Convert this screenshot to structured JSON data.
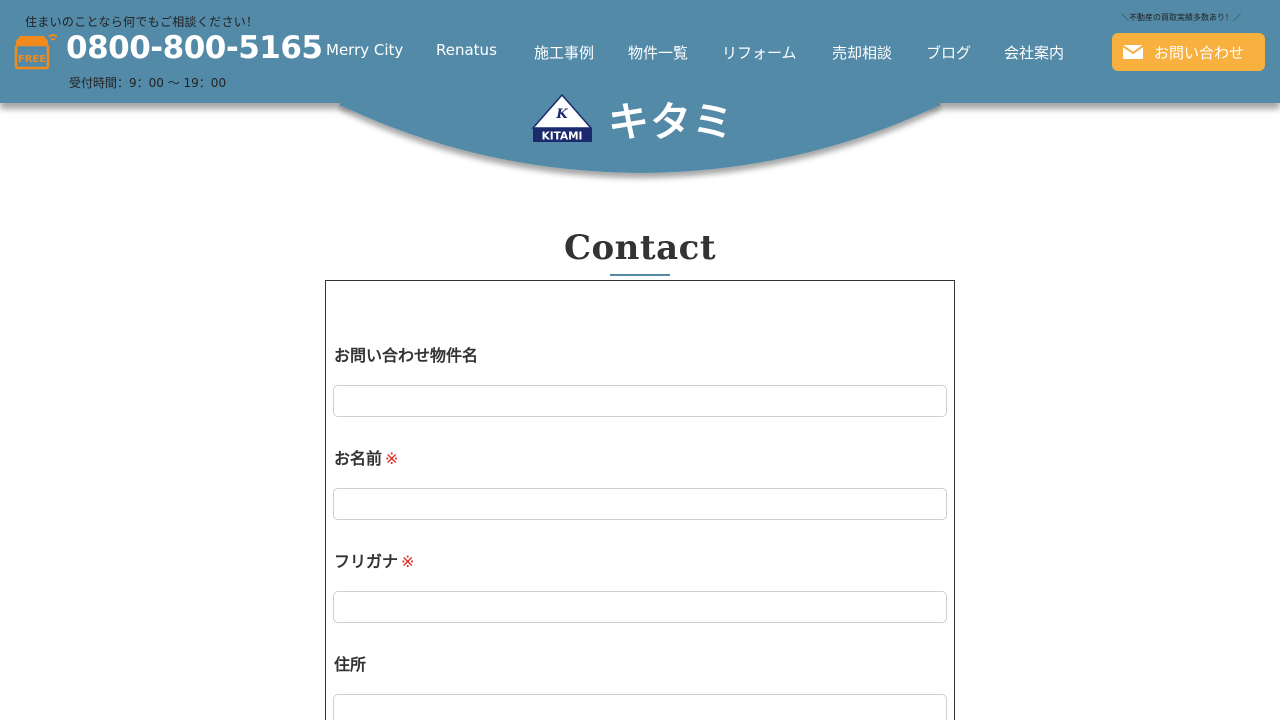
{
  "header": {
    "tagline": "住まいのことなら何でもご相談ください！",
    "phone": "0800-800-5165",
    "hours": "受付時間：9：00 〜 19：00",
    "buy_note": "＼不動産の買取実績多数あり！／",
    "contact_button": "お問い合わせ",
    "logo": {
      "badge_text": "KITAMI",
      "wordmark": "キタミ"
    },
    "nav": [
      {
        "label": "Merry City"
      },
      {
        "label": "Renatus"
      },
      {
        "label": "施工事例"
      },
      {
        "label": "物件一覧"
      },
      {
        "label": "リフォーム"
      },
      {
        "label": "売却相談"
      },
      {
        "label": "ブログ"
      },
      {
        "label": "会社案内"
      }
    ]
  },
  "main": {
    "title": "Contact",
    "form": {
      "fields": [
        {
          "label": "お問い合わせ物件名",
          "required_mark": "",
          "value": ""
        },
        {
          "label": "お名前",
          "required_mark": "※",
          "value": ""
        },
        {
          "label": "フリガナ",
          "required_mark": "※",
          "value": ""
        },
        {
          "label": "住所",
          "required_mark": "",
          "value": ""
        }
      ]
    }
  },
  "colors": {
    "header_bg": "#538aa8",
    "accent_orange": "#f8b03f",
    "required_red": "#e0281e",
    "logo_navy": "#1a2a6c"
  }
}
